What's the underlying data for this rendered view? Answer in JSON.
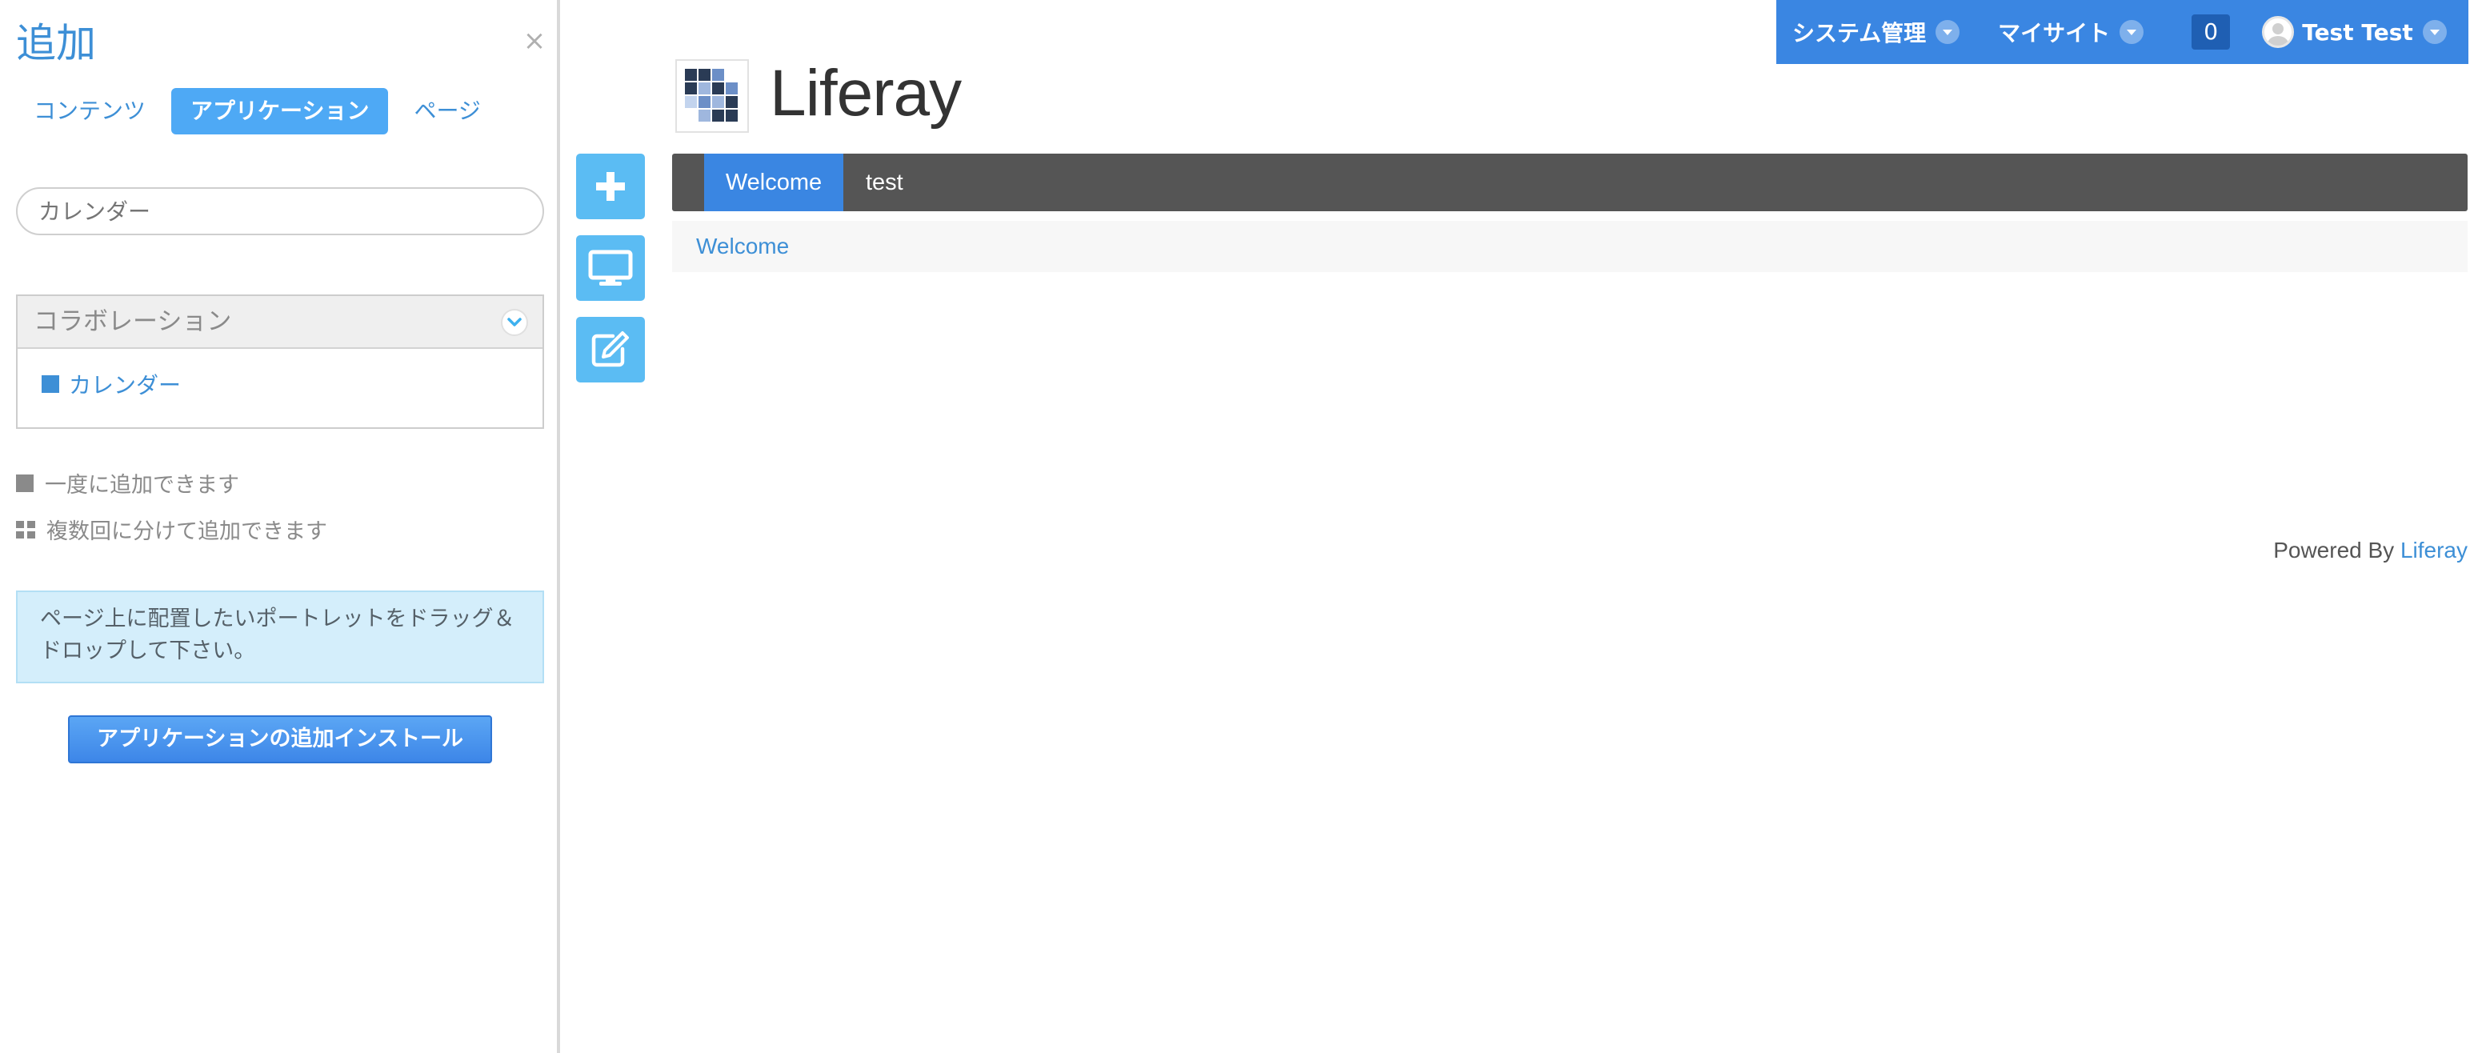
{
  "add_panel": {
    "title": "追加",
    "close_icon": "×",
    "tabs": [
      {
        "label": "コンテンツ",
        "active": false
      },
      {
        "label": "アプリケーション",
        "active": true
      },
      {
        "label": "ページ",
        "active": false
      }
    ],
    "search": {
      "value": "",
      "placeholder": "カレンダー"
    },
    "category": {
      "title": "コラボレーション",
      "expanded": true,
      "items": [
        {
          "label": "カレンダー",
          "icon": "single-instance-icon"
        }
      ]
    },
    "legend": {
      "single": "一度に追加できます",
      "multi": "複数回に分けて追加できます"
    },
    "info_message": "ページ上に配置したいポートレットをドラッグ＆ドロップして下さい。",
    "install_button": "アプリケーションの追加インストール"
  },
  "dockbar": {
    "admin": "システム管理",
    "my_sites": "マイサイト",
    "notifications": "0",
    "user": "Test Test"
  },
  "site": {
    "name": "Liferay",
    "nav": [
      {
        "label": "Welcome",
        "active": true
      },
      {
        "label": "test",
        "active": false
      }
    ],
    "breadcrumb": "Welcome",
    "footer_prefix": "Powered By",
    "footer_link": "Liferay"
  },
  "colors": {
    "accent": "#3a86e2",
    "link": "#3d8fd6",
    "action_button": "#5bbcf3",
    "nav_bar": "#555555",
    "info_bg": "#d4eefb"
  }
}
